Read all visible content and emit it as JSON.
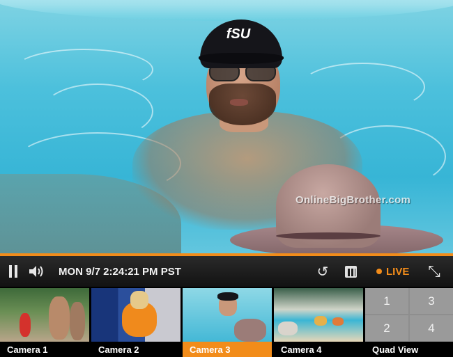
{
  "video": {
    "watermark": "OnlineBigBrother.com",
    "cap_logo": "fSU"
  },
  "controls": {
    "datetime": "MON 9/7 2:24:21 PM PST",
    "live_label": "LIVE",
    "accent_color": "#f28c1a",
    "icons": [
      "pause-icon",
      "volume-icon",
      "replay-icon",
      "calendar-icon",
      "live-dot-icon",
      "fullscreen-icon"
    ]
  },
  "cameras": [
    {
      "label": "Camera 1",
      "active": false
    },
    {
      "label": "Camera 2",
      "active": false
    },
    {
      "label": "Camera 3",
      "active": true
    },
    {
      "label": "Camera 4",
      "active": false
    },
    {
      "label": "Quad View",
      "active": false
    }
  ],
  "quad": {
    "cells": [
      "1",
      "3",
      "2",
      "4"
    ]
  }
}
